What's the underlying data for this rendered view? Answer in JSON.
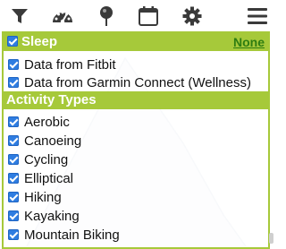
{
  "toolbar": {
    "icons": [
      "filter-icon",
      "dashboard-gauge-icon",
      "pin-icon",
      "calendar-icon",
      "gear-icon",
      "hamburger-menu-icon"
    ]
  },
  "sleep": {
    "title": "Sleep",
    "none_link": "None",
    "checked": true,
    "items": [
      {
        "label": "Data from Fitbit",
        "checked": true
      },
      {
        "label": "Data from Garmin Connect (Wellness)",
        "checked": true
      }
    ]
  },
  "activity": {
    "title": "Activity Types",
    "items": [
      {
        "label": "Aerobic",
        "checked": true
      },
      {
        "label": "Canoeing",
        "checked": true
      },
      {
        "label": "Cycling",
        "checked": true
      },
      {
        "label": "Elliptical",
        "checked": true
      },
      {
        "label": "Hiking",
        "checked": true
      },
      {
        "label": "Kayaking",
        "checked": true
      },
      {
        "label": "Mountain Biking",
        "checked": true
      }
    ]
  },
  "colors": {
    "accent_green": "#a6c93a",
    "link_green": "#2e7d11",
    "checkbox_blue": "#2f7de1",
    "icon_dark": "#3a3a3a"
  }
}
